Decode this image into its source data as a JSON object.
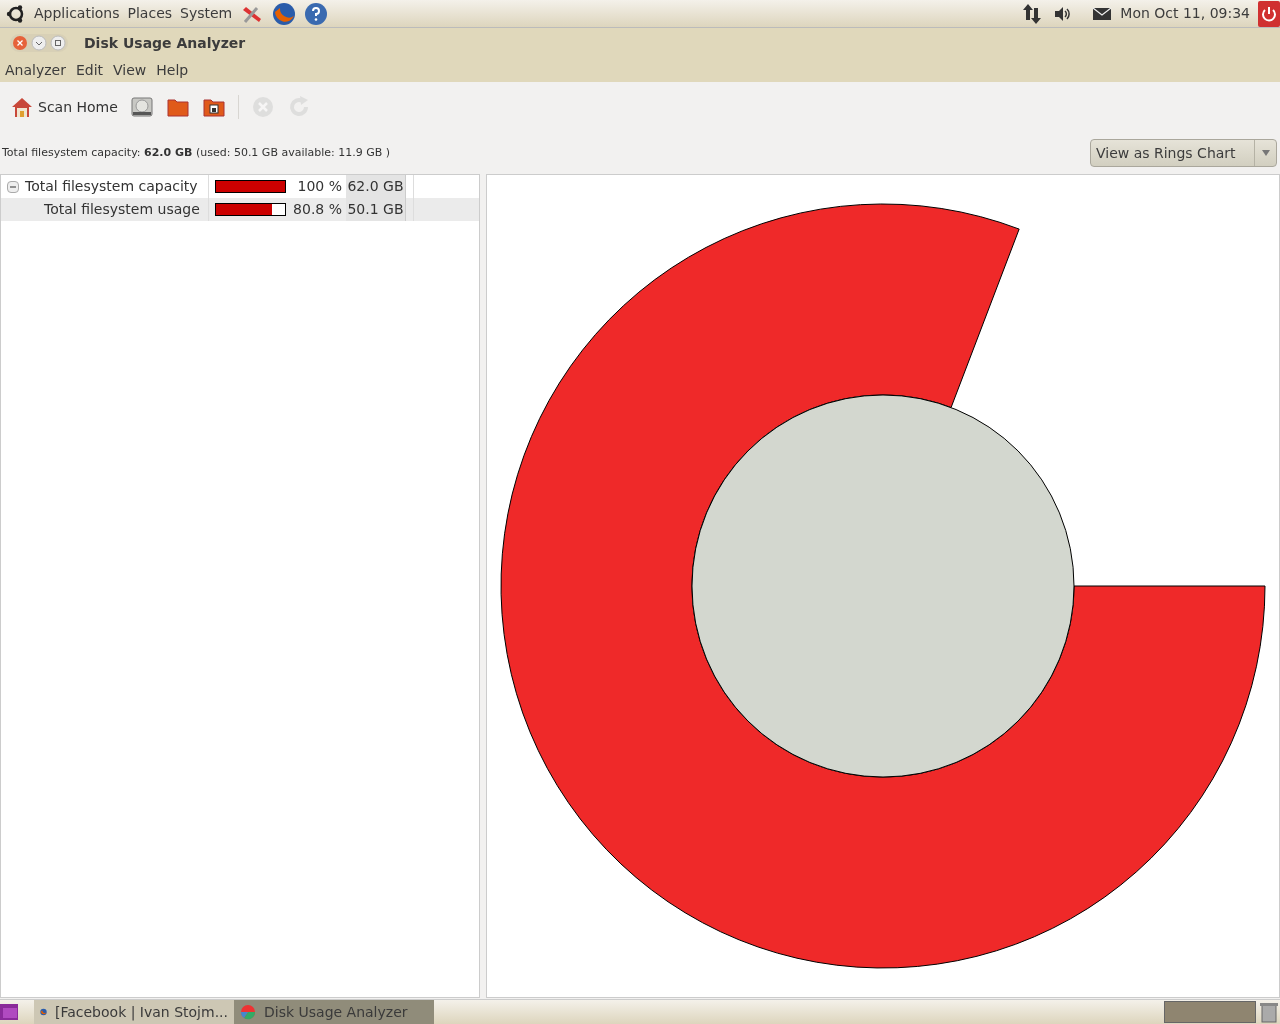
{
  "top_panel": {
    "menus": [
      "Applications",
      "Places",
      "System"
    ],
    "clock": "Mon Oct 11, 09:34"
  },
  "window": {
    "title": "Disk Usage Analyzer"
  },
  "menu_bar": [
    "Analyzer",
    "Edit",
    "View",
    "Help"
  ],
  "toolbar": [
    {
      "label": "Scan Home",
      "disabled": false
    },
    {
      "disabled": false
    },
    {
      "disabled": false
    },
    {
      "disabled": false
    },
    {
      "disabled": true
    },
    {
      "disabled": true
    }
  ],
  "summary": "Total filesystem capacity: **62.0 GB** (used: 50.1 GB available: 11.9 GB )",
  "view_selector": {
    "value": "View as Rings Chart"
  },
  "tree": [
    {
      "name": "Total filesystem capacity",
      "level": 1,
      "percent": "100 %",
      "size": "62.0 GB",
      "expanded": true,
      "selected": false,
      "children": [
        {
          "name": "Total filesystem usage",
          "level": 0.808,
          "percent": "80.8 %",
          "size": "50.1 GB",
          "selected": true
        }
      ]
    }
  ],
  "taskbar": [
    {
      "label": "[Facebook | Ivan Stojm...",
      "selected": false
    },
    {
      "label": "Disk Usage Analyzer",
      "selected": true
    }
  ]
}
